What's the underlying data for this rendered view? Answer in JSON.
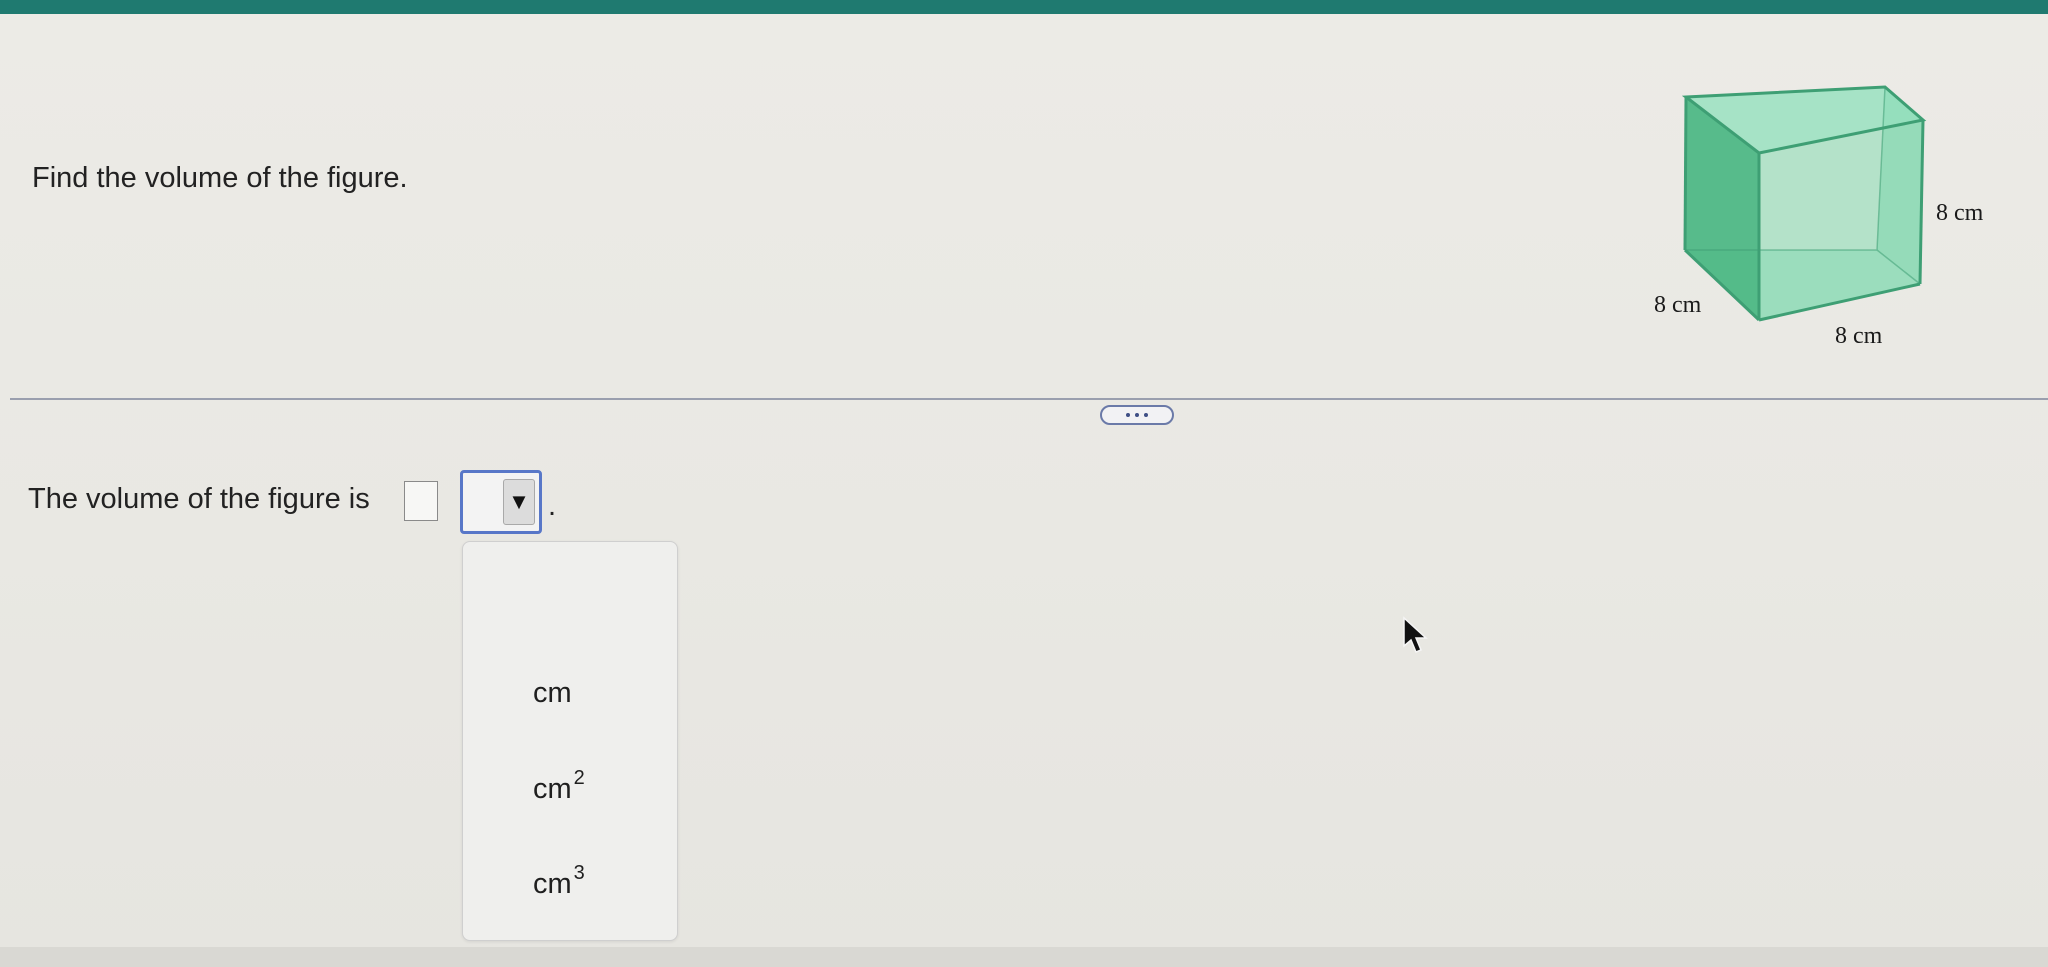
{
  "question": {
    "prompt": "Find the volume of the figure."
  },
  "figure": {
    "labels": {
      "height": "8 cm",
      "depth": "8 cm",
      "width": "8 cm"
    },
    "face_color": "#5fc79a",
    "edge_color": "#3e9f74"
  },
  "toolbar": {
    "more_icon": "ellipsis-icon"
  },
  "answer": {
    "sentence": "The volume of the figure is",
    "value": "",
    "unit_selected": "",
    "caret": "▼",
    "period": "."
  },
  "unit_options": [
    {
      "base": "cm",
      "exponent": ""
    },
    {
      "base": "cm",
      "exponent": "2"
    },
    {
      "base": "cm",
      "exponent": "3"
    }
  ],
  "colors": {
    "accent": "#5877c8",
    "header": "#1f7a70",
    "divider": "#9a9fae"
  }
}
